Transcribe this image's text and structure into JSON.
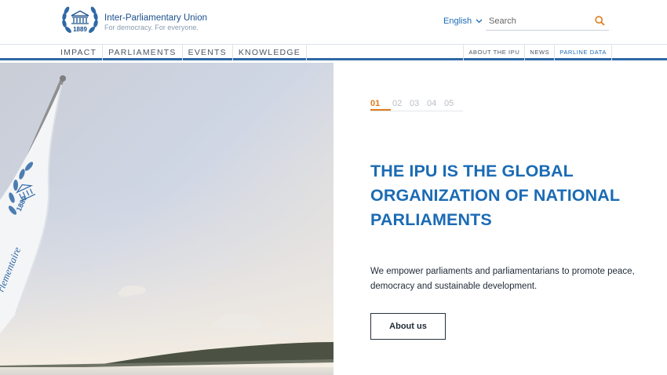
{
  "brand": {
    "name": "Inter-Parliamentary Union",
    "tagline": "For democracy. For everyone.",
    "logo_year": "1889"
  },
  "header": {
    "language": "English",
    "search_placeholder": "Search"
  },
  "nav": {
    "main": [
      "IMPACT",
      "PARLIAMENTS",
      "EVENTS",
      "KNOWLEDGE"
    ],
    "secondary": [
      "ABOUT THE IPU",
      "NEWS",
      "PARLINE DATA"
    ]
  },
  "hero": {
    "slides": [
      "01",
      "02",
      "03",
      "04",
      "05"
    ],
    "active_slide": "01",
    "headline": "THE IPU IS THE GLOBAL ORGANIZATION OF NATIONAL PARLIAMENTS",
    "description": "We empower parliaments and parliamentarians to promote peace, democracy and sustainable development.",
    "cta_label": "About us",
    "flag_text": "rlementaire"
  },
  "colors": {
    "brand_blue": "#1b6bb5",
    "accent_orange": "#e07c1a",
    "nav_rule": "#2f69a6"
  }
}
